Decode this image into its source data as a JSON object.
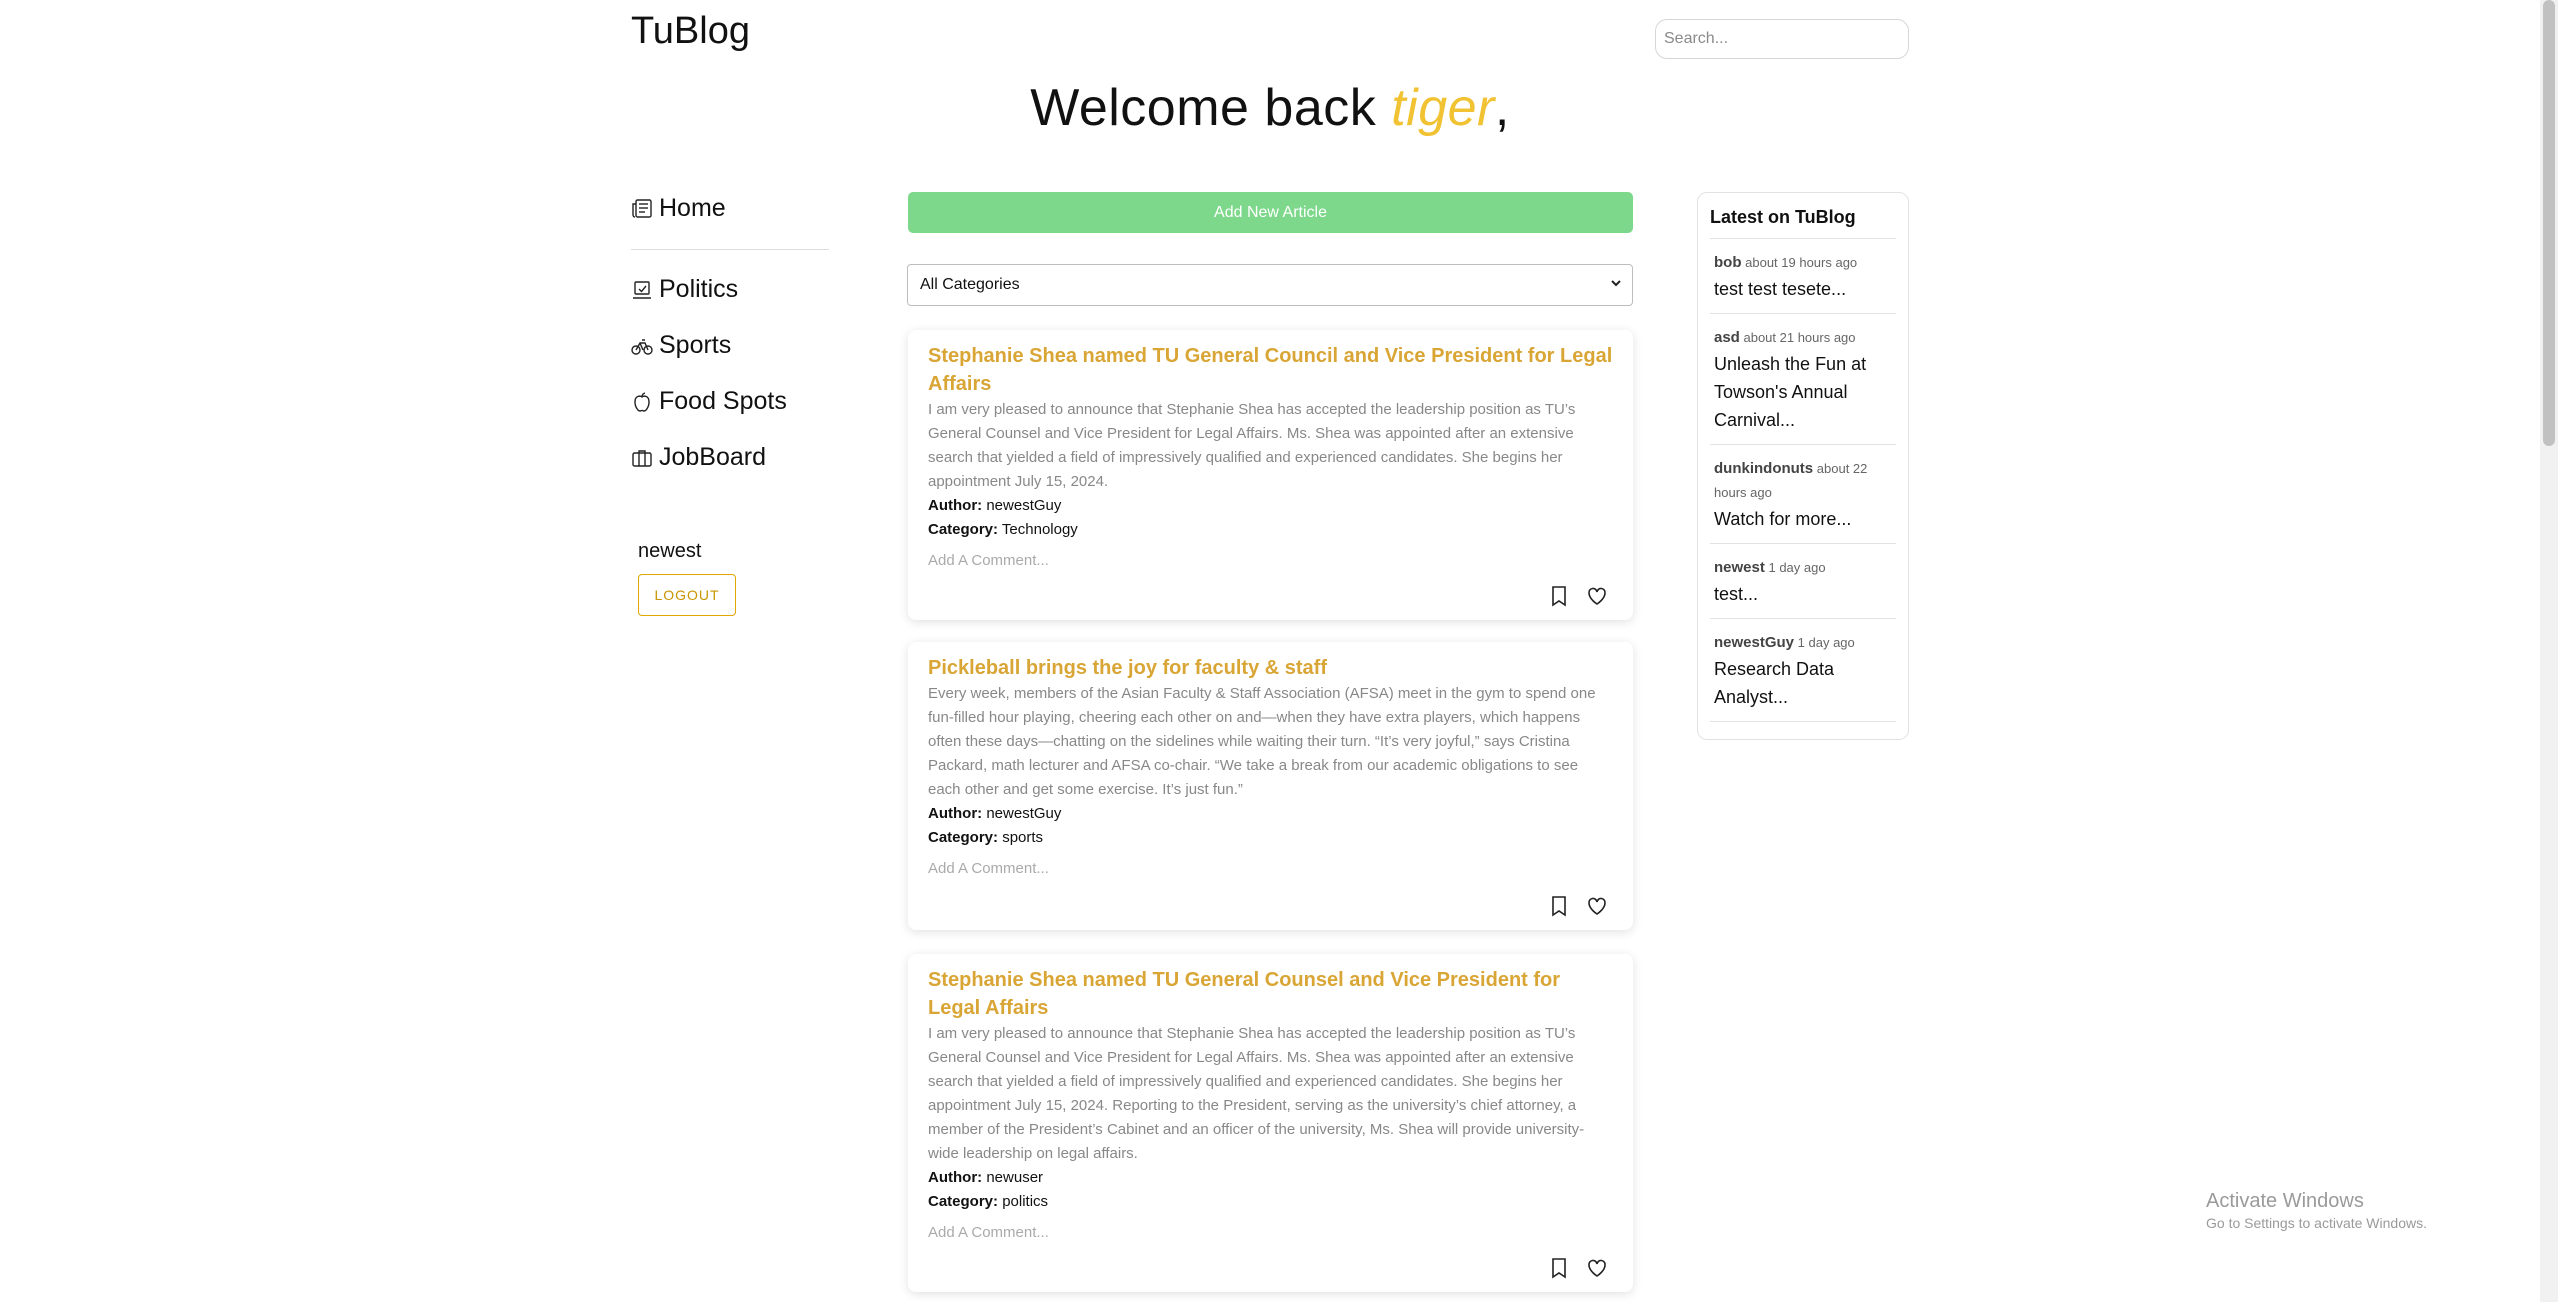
{
  "brand": "TuBlog",
  "search": {
    "placeholder": "Search..."
  },
  "welcome": {
    "prefix": "Welcome back ",
    "name": "tiger",
    "suffix": ","
  },
  "sidebar": {
    "home": "Home",
    "categories": [
      {
        "label": "Politics",
        "icon": "ballot-icon"
      },
      {
        "label": "Sports",
        "icon": "bicycle-icon"
      },
      {
        "label": "Food Spots",
        "icon": "apple-icon"
      },
      {
        "label": "JobBoard",
        "icon": "briefcase-icon"
      }
    ],
    "username": "newest",
    "logout": "LOGOUT"
  },
  "main": {
    "add_button": "Add New Article",
    "category_select": "All Categories",
    "articles": [
      {
        "title": "Stephanie Shea named TU General Council and Vice President for Legal Affairs",
        "body": "I am very pleased to announce that Stephanie Shea has accepted the leadership position as TU’s General Counsel and Vice President for Legal Affairs. Ms. Shea was appointed after an extensive search that yielded a field of impressively qualified and experienced candidates. She begins her appointment July 15, 2024.",
        "author_label": "Author:",
        "author": "newestGuy",
        "category_label": "Category:",
        "category": "Technology",
        "comment_placeholder": "Add A Comment..."
      },
      {
        "title": "Pickleball brings the joy for faculty & staff",
        "body": "Every week, members of the Asian Faculty & Staff Association (AFSA) meet in the gym to spend one fun-filled hour playing, cheering each other on and—when they have extra players, which happens often these days—chatting on the sidelines while waiting their turn. “It’s very joyful,” says Cristina Packard, math lecturer and AFSA co-chair. “We take a break from our academic obligations to see each other and get some exercise. It’s just fun.”",
        "author_label": "Author:",
        "author": "newestGuy",
        "category_label": "Category:",
        "category": "sports",
        "comment_placeholder": "Add A Comment..."
      },
      {
        "title": "Stephanie Shea named TU General Counsel and Vice President for Legal Affairs",
        "body": "I am very pleased to announce that Stephanie Shea has accepted the leadership position as TU’s General Counsel and Vice President for Legal Affairs. Ms. Shea was appointed after an extensive search that yielded a field of impressively qualified and experienced candidates. She begins her appointment July 15, 2024. Reporting to the President, serving as the university’s chief attorney, a member of the President’s Cabinet and an officer of the university, Ms. Shea will provide university-wide leadership on legal affairs.",
        "author_label": "Author:",
        "author": "newuser",
        "category_label": "Category:",
        "category": "politics",
        "comment_placeholder": "Add A Comment..."
      }
    ]
  },
  "latest": {
    "title": "Latest on TuBlog",
    "items": [
      {
        "user": "bob",
        "time": "about 19 hours ago",
        "text": "test test tesete..."
      },
      {
        "user": "asd",
        "time": "about 21 hours ago",
        "text": "Unleash the Fun at Towson's Annual Carnival..."
      },
      {
        "user": "dunkindonuts",
        "time": "about 22 hours ago",
        "text": "Watch for more..."
      },
      {
        "user": "newest",
        "time": "1 day ago",
        "text": "test..."
      },
      {
        "user": "newestGuy",
        "time": "1 day ago",
        "text": "Research Data Analyst..."
      }
    ]
  },
  "os_watermark": {
    "line1": "Activate Windows",
    "line2": "Go to Settings to activate Windows."
  },
  "colors": {
    "accent": "#d9a535",
    "welcome_name": "#f1c232",
    "add_button": "#7ed88b",
    "logout": "#e0a800"
  }
}
